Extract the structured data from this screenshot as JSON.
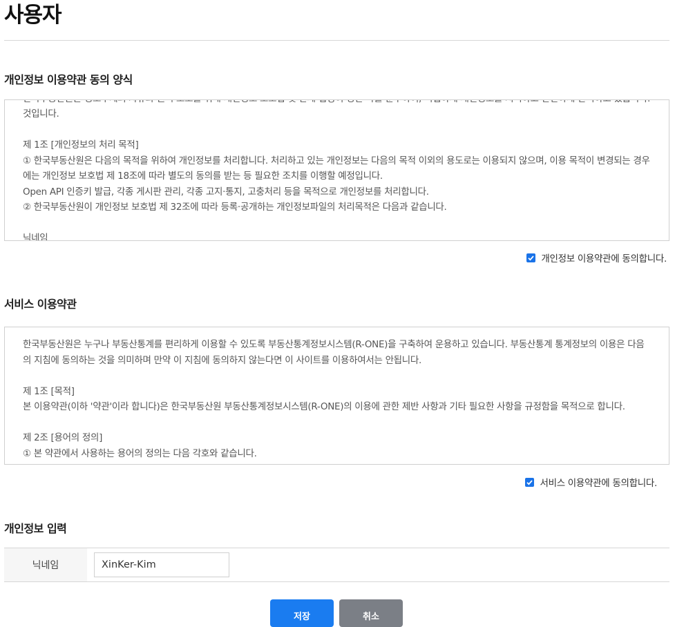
{
  "page": {
    "title": "사용자"
  },
  "privacy_terms": {
    "heading": "개인정보 이용약관 동의 양식",
    "clipped_top": "한국부동산원은 정보주체의 자유와 권리 보호를 위해 개인정보 보호법 및 관계 법령이 정한 바를 준수하여, 적법하게 개인정보를 처리하고 안전하게 관리하고 있습니다.",
    "body": "것입니다.\n\n제 1조 [개인정보의 처리 목적]\n① 한국부동산원은 다음의 목적을 위하여 개인정보를 처리합니다. 처리하고 있는 개인정보는 다음의 목적 이외의 용도로는 이용되지 않으며, 이용 목적이 변경되는 경우에는 개인정보 보호법 제 18조에 따라 별도의 동의를 받는 등 필요한 조치를 이행할 예정입니다.\nOpen API 인증키 발급, 각종 게시판 관리, 각종 고지·통지, 고충처리 등을 목적으로 개인정보를 처리합니다.\n② 한국부동산원이 개인정보 보호법 제 32조에 따라 등록·공개하는 개인정보파일의 처리목적은 다음과 같습니다.\n\n닉네임",
    "agree_label": "개인정보 이용약관에 동의합니다.",
    "agreed": true
  },
  "service_terms": {
    "heading": "서비스 이용약관",
    "body": "한국부동산원은 누구나 부동산통계를 편리하게 이용할 수 있도록 부동산통계정보시스템(R-ONE)을 구축하여 운용하고 있습니다. 부동산통계 통계정보의 이용은 다음의 지침에 동의하는 것을 의미하며 만약 이 지침에 동의하지 않는다면 이 사이트를 이용하여서는 안됩니다.\n\n제 1조 [목적]\n본 이용약관(이하 '약관'이라 합니다)은 한국부동산원 부동산통계정보시스템(R-ONE)의 이용에 관한 제반 사항과 기타 필요한 사항을 규정함을 목적으로 합니다.\n\n제 2조 [용어의 정의]\n① 본 약관에서 사용하는 용어의 정의는 다음 각호와 같습니다.",
    "agree_label": "서비스 이용약관에 동의합니다.",
    "agreed": true
  },
  "personal_info": {
    "heading": "개인정보 입력",
    "nickname_label": "닉네임",
    "nickname_value": "XinKer-Kim"
  },
  "buttons": {
    "save": "저장",
    "cancel": "취소"
  },
  "colors": {
    "accent": "#1a7cf0",
    "cancel": "#7b7f86",
    "checkbox": "#1a73e8"
  }
}
